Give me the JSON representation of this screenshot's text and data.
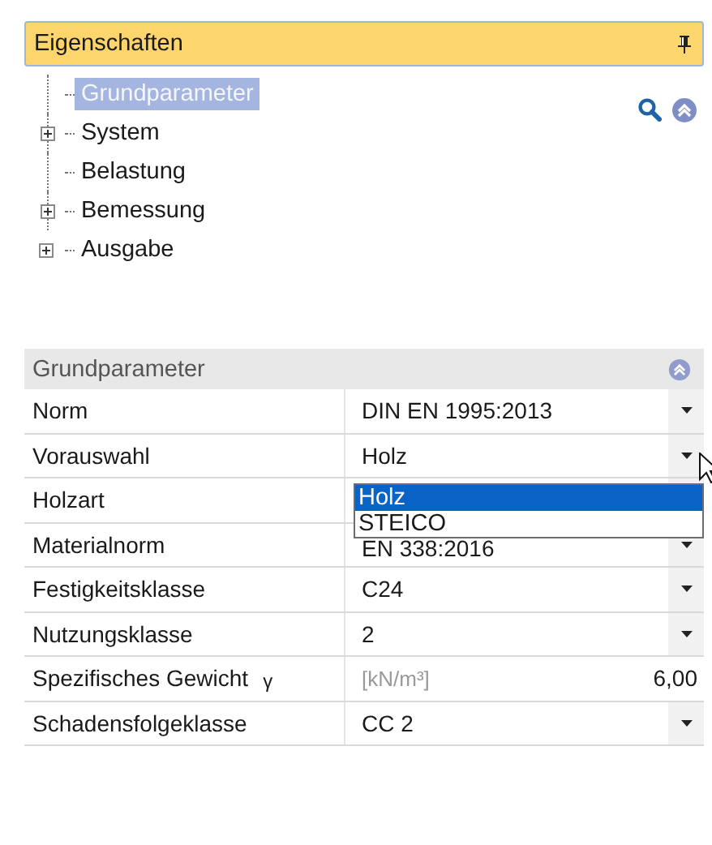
{
  "panel": {
    "title": "Eigenschaften"
  },
  "tree": [
    {
      "label": "Grundparameter",
      "kind": "leaf",
      "selected": true
    },
    {
      "label": "System",
      "kind": "group",
      "expanded": false,
      "selected": false
    },
    {
      "label": "Belastung",
      "kind": "leaf",
      "selected": false
    },
    {
      "label": "Bemessung",
      "kind": "group",
      "expanded": false,
      "selected": false
    },
    {
      "label": "Ausgabe",
      "kind": "group",
      "expanded": false,
      "selected": false
    }
  ],
  "grid": {
    "title": "Grundparameter",
    "rows": [
      {
        "label": "Norm",
        "kind": "dropdown",
        "value": "DIN EN 1995:2013"
      },
      {
        "label": "Vorauswahl",
        "kind": "dropdown",
        "value": "Holz",
        "open": true,
        "options": [
          {
            "label": "Holz",
            "selected": true
          },
          {
            "label": "STEICO",
            "selected": false
          }
        ]
      },
      {
        "label": "Holzart",
        "kind": "covered"
      },
      {
        "label": "Materialnorm",
        "kind": "dropdown",
        "value": "EN 338:2016"
      },
      {
        "label": "Festigkeitsklasse",
        "kind": "dropdown",
        "value": "C24"
      },
      {
        "label": "Nutzungsklasse",
        "kind": "dropdown",
        "value": "2"
      },
      {
        "label": "Spezifisches Gewicht",
        "symbol": "γ",
        "kind": "number",
        "unit": "[kN/m³]",
        "value": "6,00"
      },
      {
        "label": "Schadensfolgeklasse",
        "kind": "dropdown",
        "value": "CC 2"
      }
    ]
  }
}
